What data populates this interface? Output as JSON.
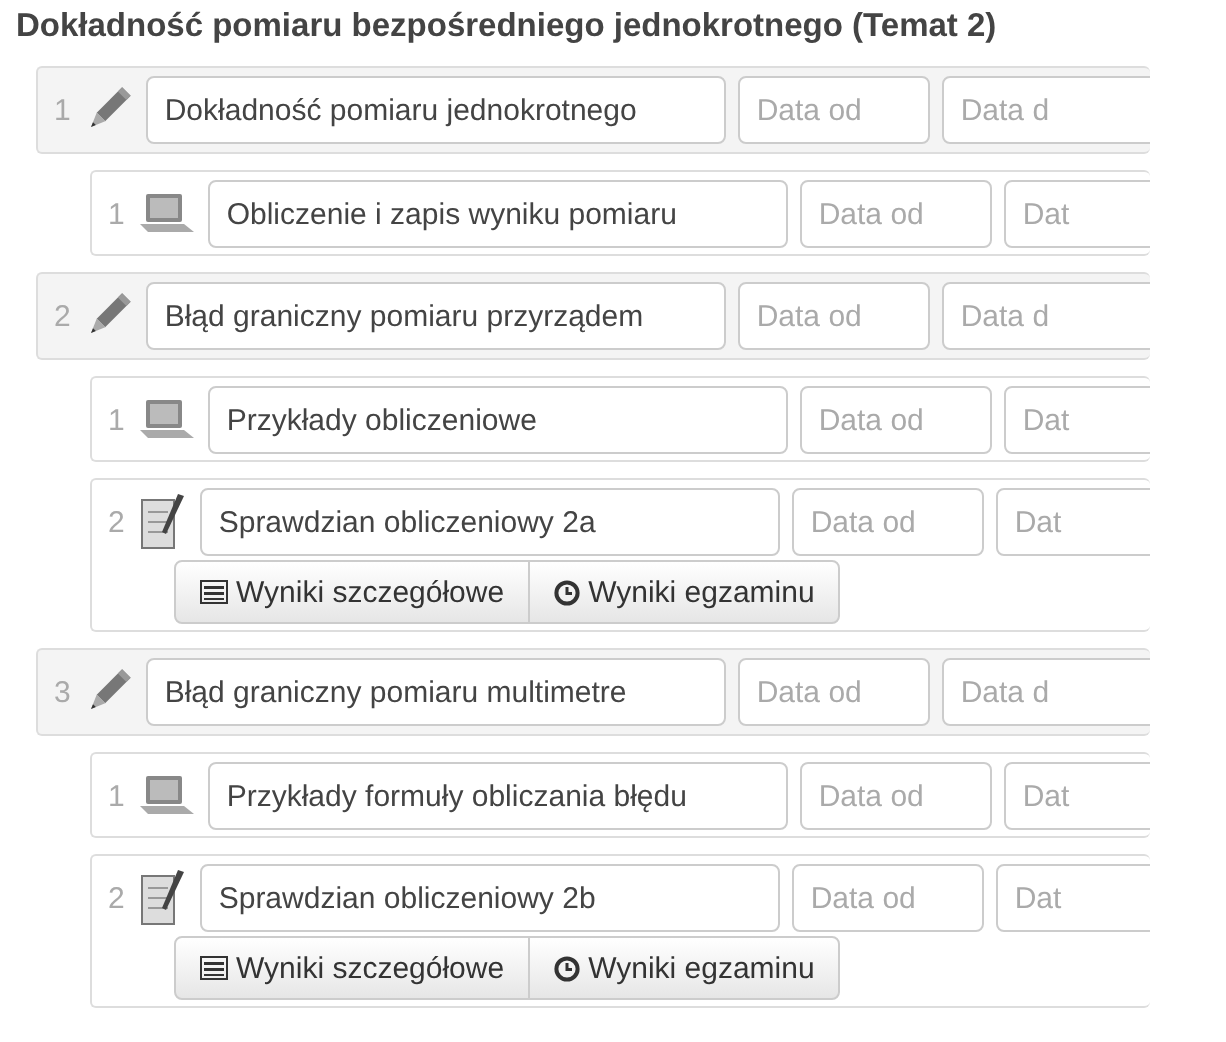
{
  "heading": "Dokładność pomiaru bezpośredniego jednokrotnego (Temat 2)",
  "topics": [
    {
      "number": "1",
      "title": "Dokładność pomiaru jednokrotnego",
      "date_from": {
        "placeholder": "Data od"
      },
      "date_to": {
        "placeholder": "Data d"
      },
      "children": [
        {
          "number": "1",
          "kind": "lesson",
          "title": "Obliczenie i zapis wyniku pomiaru",
          "date_from": {
            "placeholder": "Data od"
          },
          "date_to": {
            "placeholder": "Dat"
          }
        }
      ]
    },
    {
      "number": "2",
      "title": "Błąd graniczny pomiaru przyrządem",
      "date_from": {
        "placeholder": "Data od"
      },
      "date_to": {
        "placeholder": "Data d"
      },
      "children": [
        {
          "number": "1",
          "kind": "lesson",
          "title": "Przykłady obliczeniowe",
          "date_from": {
            "placeholder": "Data od"
          },
          "date_to": {
            "placeholder": "Dat"
          }
        },
        {
          "number": "2",
          "kind": "test",
          "title": "Sprawdzian obliczeniowy 2a",
          "date_from": {
            "placeholder": "Data od"
          },
          "date_to": {
            "placeholder": "Dat"
          },
          "buttons": [
            {
              "kind": "details",
              "label": "Wyniki szczegółowe"
            },
            {
              "kind": "exam",
              "label": "Wyniki egzaminu"
            }
          ]
        }
      ]
    },
    {
      "number": "3",
      "title": "Błąd graniczny pomiaru multimetre",
      "date_from": {
        "placeholder": "Data od"
      },
      "date_to": {
        "placeholder": "Data d"
      },
      "children": [
        {
          "number": "1",
          "kind": "lesson",
          "title": "Przykłady formuły obliczania błędu",
          "date_from": {
            "placeholder": "Data od"
          },
          "date_to": {
            "placeholder": "Dat"
          }
        },
        {
          "number": "2",
          "kind": "test",
          "title": "Sprawdzian obliczeniowy 2b",
          "date_from": {
            "placeholder": "Data od"
          },
          "date_to": {
            "placeholder": "Dat"
          },
          "buttons": [
            {
              "kind": "details",
              "label": "Wyniki szczegółowe"
            },
            {
              "kind": "exam",
              "label": "Wyniki egzaminu"
            }
          ]
        }
      ]
    }
  ]
}
